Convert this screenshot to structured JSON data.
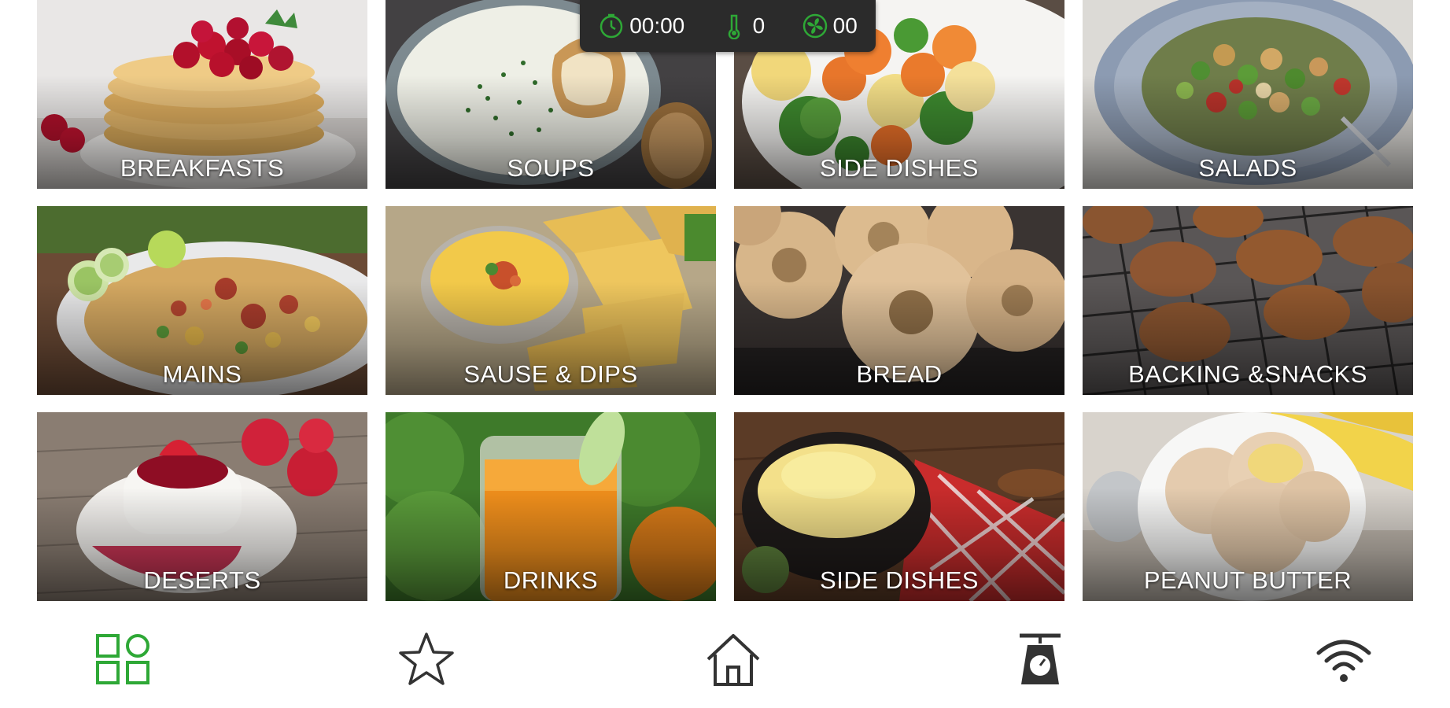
{
  "status_bar": {
    "timer": "00:00",
    "speed": "0",
    "fan": "00",
    "icons": [
      "timer-icon",
      "thermometer-icon",
      "fan-icon"
    ]
  },
  "categories": [
    {
      "label": "BREAKFASTS"
    },
    {
      "label": "SOUPS"
    },
    {
      "label": "SIDE DISHES"
    },
    {
      "label": "SALADS"
    },
    {
      "label": "MAINS"
    },
    {
      "label": "SAUSE & DIPS"
    },
    {
      "label": "BREAD"
    },
    {
      "label": "BACKING &SNACKS"
    },
    {
      "label": "DESERTS"
    },
    {
      "label": "DRINKS"
    },
    {
      "label": "SIDE DISHES"
    },
    {
      "label": "PEANUT BUTTER"
    }
  ],
  "bottom_nav": {
    "items": [
      "grid-icon",
      "star-icon",
      "home-icon",
      "scale-icon",
      "wifi-icon"
    ],
    "active": "grid-icon"
  },
  "colors": {
    "accent_green": "#2ea836",
    "status_bg": "#2b2b2b",
    "nav_icon": "#333333"
  }
}
